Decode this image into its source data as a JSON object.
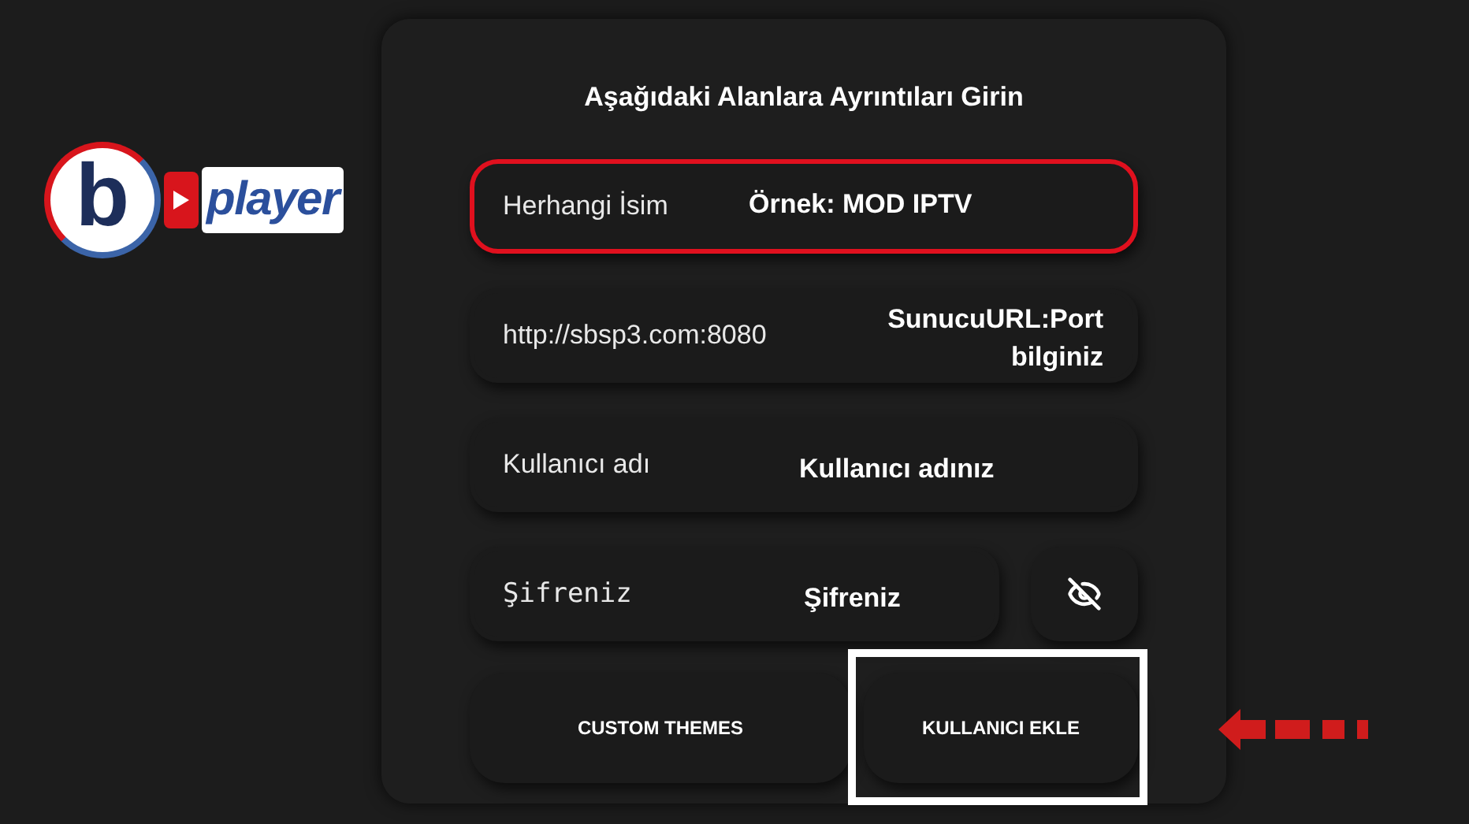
{
  "logo": {
    "mark": "b",
    "text": "player"
  },
  "form": {
    "title": "Aşağıdaki Alanlara Ayrıntıları Girin",
    "fields": [
      {
        "kind": "text",
        "placeholder": "Herhangi İsim",
        "highlighted": true,
        "annotation": "Örnek: MOD IPTV"
      },
      {
        "kind": "text",
        "value": "http://sbsp3.com:8080",
        "highlighted": false,
        "annotation": "SunucuURL:Port bilginiz"
      },
      {
        "kind": "text",
        "placeholder": "Kullanıcı adı",
        "highlighted": false,
        "annotation": "Kullanıcı adınız"
      },
      {
        "kind": "password",
        "placeholder": "Şifreniz",
        "highlighted": false,
        "annotation": "Şifreniz"
      }
    ],
    "buttons": [
      {
        "label": "CUSTOM THEMES",
        "highlighted": false
      },
      {
        "label": "KULLANICI EKLE",
        "highlighted": true
      }
    ]
  }
}
